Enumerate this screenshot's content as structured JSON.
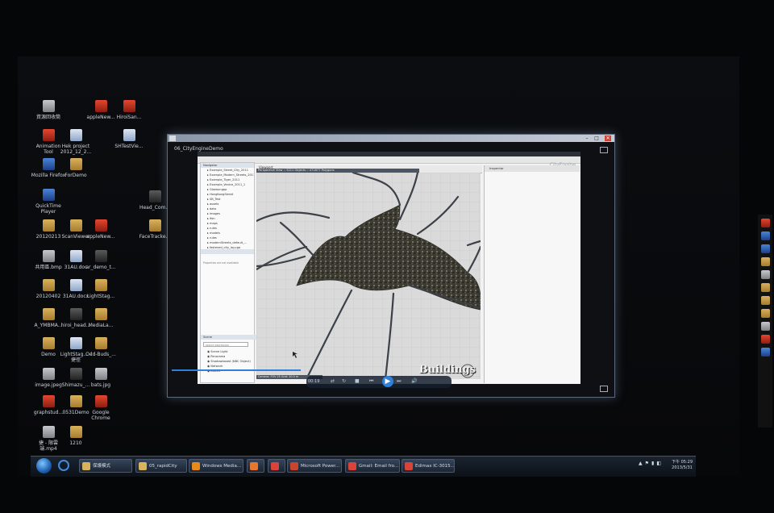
{
  "desktop_icons": [
    {
      "label": "資源回收筒",
      "icon": "recycle-bin-icon"
    },
    {
      "label": "appleNew...",
      "icon": "app-icon"
    },
    {
      "label": "HiroiSan...",
      "icon": "app-icon"
    },
    {
      "label": "Animation Tool",
      "icon": "app-icon"
    },
    {
      "label": "Hek project 2012_12_2...",
      "icon": "doc-icon"
    },
    {
      "label": "SHTestVie...",
      "icon": "doc-icon"
    },
    {
      "label": "Mozilla Firefox",
      "icon": "firefox-icon"
    },
    {
      "label": "ForDemo",
      "icon": "folder-icon"
    },
    {
      "label": "Head_Com...",
      "icon": "file-icon"
    },
    {
      "label": "QuickTime Player",
      "icon": "quicktime-icon"
    },
    {
      "label": "20120213",
      "icon": "folder-icon"
    },
    {
      "label": "ScanViewer",
      "icon": "folder-icon"
    },
    {
      "label": "appleNew...",
      "icon": "app-icon"
    },
    {
      "label": "FaceTracke...",
      "icon": "folder-icon"
    },
    {
      "label": "共用區.bmp",
      "icon": "image-icon"
    },
    {
      "label": "31AU.doc",
      "icon": "doc-icon"
    },
    {
      "label": "ar_demo_t...",
      "icon": "file-icon"
    },
    {
      "label": "20120402",
      "icon": "folder-icon"
    },
    {
      "label": "31AU.docx",
      "icon": "doc-icon"
    },
    {
      "label": "LightStag...",
      "icon": "folder-icon"
    },
    {
      "label": "A_YMBMA...",
      "icon": "folder-icon"
    },
    {
      "label": "hiroi_head...",
      "icon": "file-icon"
    },
    {
      "label": "MediaLa...",
      "icon": "folder-icon"
    },
    {
      "label": "Demo",
      "icon": "folder-icon"
    },
    {
      "label": "LightStag... - 捷徑",
      "icon": "shortcut-icon"
    },
    {
      "label": "Odd-Buds_...",
      "icon": "folder-icon"
    },
    {
      "label": "image.jpeg",
      "icon": "image-icon"
    },
    {
      "label": "Shimazu_...",
      "icon": "file-icon"
    },
    {
      "label": "bats.jpg",
      "icon": "image-icon"
    },
    {
      "label": "graphstud...",
      "icon": "app-icon"
    },
    {
      "label": "0531Demo",
      "icon": "folder-icon"
    },
    {
      "label": "Google Chrome",
      "icon": "chrome-icon"
    },
    {
      "label": "捷 - 限雲端.mp4",
      "icon": "video-icon"
    },
    {
      "label": "1210",
      "icon": "folder-icon"
    }
  ],
  "player_window": {
    "title": "06_CityEngineDemo",
    "controls": {
      "minimize": "–",
      "maximize": "□",
      "close": "✕"
    },
    "fullscreen_icon": "fullscreen-icon"
  },
  "cityengine": {
    "brand": "CityEngine",
    "navigator_title": "Navigator",
    "navigator_items": [
      "Example_Street_City_2011",
      "Example_Modern_Streets_2011",
      "Example_Tiger_2011",
      "Example_Venice_2011_1",
      "Giseoungpp",
      "HongKongStreet",
      "SB_Test",
      "assets",
      "data",
      "images",
      "lfon",
      "maps",
      "rules",
      "models",
      "rules",
      "modernStreets_default_...",
      "fastened_city_lay.cga"
    ],
    "properties_label": "Properties are not available",
    "scene_title": "Scene",
    "scene_search_placeholder": "search expression",
    "scene_items": [
      "Scene Light",
      "Panorama",
      "Shadowboxed (NBC Object)",
      "Network",
      "Blocks"
    ],
    "viewport_title": "Viewport",
    "viewport_status": "Perspective View  ::  5211 Objects  ::  471877 Polygons",
    "viewport_bottom_status": "Camera: FOV 25  Grid: 20.0 m",
    "inspector_title": "Inspector",
    "overlay_caption": "Buildings"
  },
  "media_controls": {
    "time": "00:19",
    "buttons": [
      "shuffle-icon",
      "repeat-icon",
      "stop-icon",
      "previous-icon",
      "play-icon",
      "next-icon",
      "volume-icon"
    ]
  },
  "taskbar": {
    "start": "start-orb-icon",
    "items": [
      {
        "label": "保護模式",
        "icon": "folder-icon"
      },
      {
        "label": "05_rapidCity",
        "icon": "folder-icon"
      },
      {
        "label": "Windows Media...",
        "icon": "media-player-icon"
      },
      {
        "label": "",
        "icon": "firefox-icon"
      },
      {
        "label": "",
        "icon": "chrome-icon"
      },
      {
        "label": "Microsoft Power...",
        "icon": "powerpoint-icon"
      },
      {
        "label": "Gmail: Email fro...",
        "icon": "chrome-icon"
      },
      {
        "label": "Edimax IC-3015...",
        "icon": "chrome-icon"
      }
    ],
    "clock_time": "下午 05:29",
    "clock_date": "2013/5/31"
  },
  "colors": {
    "screen_bg": "#07080a",
    "city": "#3a3a33",
    "road": "#3d4148",
    "accent_blue": "#2f80d9"
  }
}
